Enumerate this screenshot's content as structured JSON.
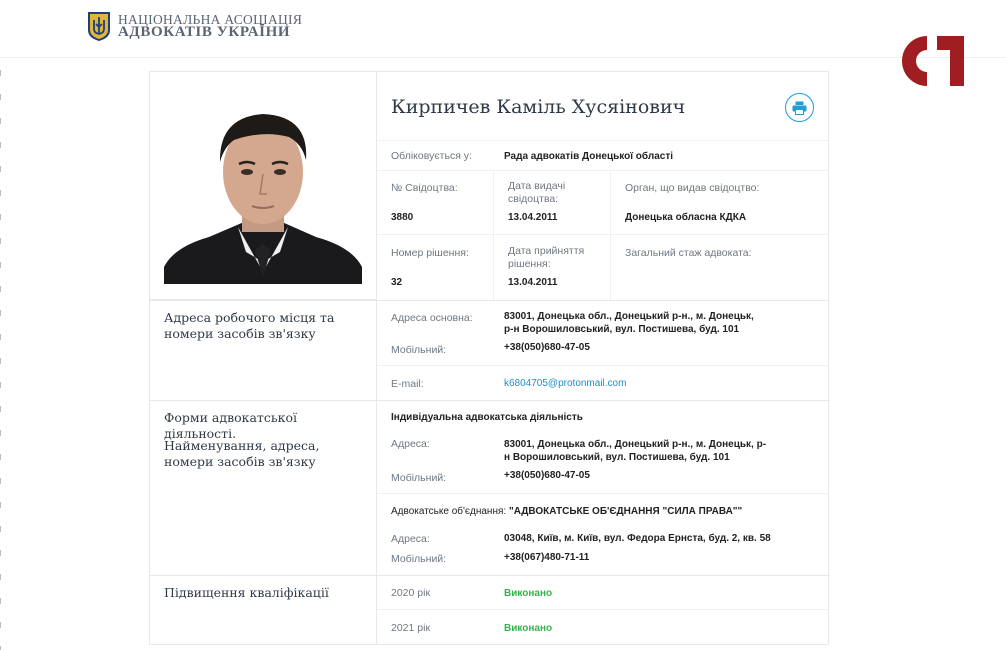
{
  "header": {
    "logo_line1": "НАЦІОНАЛЬНА АСОЦІАЦІЯ",
    "logo_line2": "АДВОКАТІВ УКРАЇНИ"
  },
  "watermark": {
    "text": "CI",
    "color": "#a01e22"
  },
  "colors": {
    "accent": "#1e9fd8",
    "success": "#34b34a"
  },
  "profile": {
    "name": "Кирпичев Каміль Хусяінович",
    "print_icon": "printer-icon",
    "registered_label": "Обліковується у:",
    "registered_value": "Рада адвокатів Донецької області",
    "cert_no_label": "№ Свідоцтва:",
    "cert_no_value": "3880",
    "cert_date_label": "Дата видачі свідоцтва:",
    "cert_date_value": "13.04.2011",
    "issuer_label": "Орган, що видав свідоцтво:",
    "issuer_value": "Донецька обласна КДКА",
    "decision_no_label": "Номер рішення:",
    "decision_no_value": "32",
    "decision_date_label": "Дата прийняття рішення:",
    "decision_date_value": "13.04.2011",
    "experience_label": "Загальний стаж адвоката:"
  },
  "workplace": {
    "section_title": "Адреса робочого місця та номери засобів зв'язку",
    "address_label": "Адреса основна:",
    "address_value": "83001, Донецька обл., Донецький р-н., м. Донецьк, р-н Ворошиловський, вул. Постишева, буд. 101",
    "mobile_label": "Мобільний:",
    "mobile_value": "+38(050)680-47-05",
    "email_label": "E-mail:",
    "email_value": "k6804705@protonmail.com"
  },
  "forms": {
    "section_title_1": "Форми адвокатської діяльності.",
    "section_title_2": "Найменування, адреса, номери засобів зв'язку",
    "individual": {
      "title": "Індивідуальна адвокатська діяльність",
      "address_label": "Адреса:",
      "address_value": "83001, Донецька обл., Донецький р-н., м. Донецьк, р-н Ворошиловський, вул. Постишева, буд. 101",
      "mobile_label": "Мобільний:",
      "mobile_value": "+38(050)680-47-05"
    },
    "association": {
      "prefix": "Адвокатське об'єднання:",
      "name": "\"АДВОКАТСЬКЕ ОБ'ЄДНАННЯ \"СИЛА ПРАВА\"\"",
      "address_label": "Адреса:",
      "address_value": "03048, Київ, м. Київ, вул. Федора Ернста, буд. 2, кв. 58",
      "mobile_label": "Мобільний:",
      "mobile_value": "+38(067)480-71-11"
    }
  },
  "qualification": {
    "section_title": "Підвищення кваліфікації",
    "rows": [
      {
        "year": "2020 рік",
        "status": "Виконано"
      },
      {
        "year": "2021 рік",
        "status": "Виконано"
      }
    ]
  }
}
